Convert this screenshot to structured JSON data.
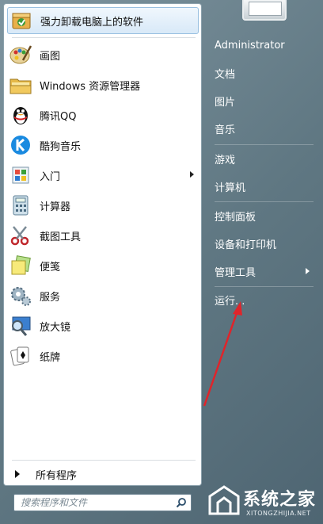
{
  "left_pane": {
    "pinned": {
      "label": "强力卸载电脑上的软件",
      "icon": "uninstall-box-icon"
    },
    "programs": [
      {
        "label": "画图",
        "icon": "paint-palette-icon",
        "submenu": false
      },
      {
        "label": "Windows 资源管理器",
        "icon": "folder-explorer-icon",
        "submenu": false
      },
      {
        "label": "腾讯QQ",
        "icon": "qq-penguin-icon",
        "submenu": false
      },
      {
        "label": "酷狗音乐",
        "icon": "kugou-k-icon",
        "submenu": false
      },
      {
        "label": "入门",
        "icon": "getting-started-icon",
        "submenu": true
      },
      {
        "label": "计算器",
        "icon": "calculator-icon",
        "submenu": false
      },
      {
        "label": "截图工具",
        "icon": "scissors-icon",
        "submenu": false
      },
      {
        "label": "便笺",
        "icon": "sticky-notes-icon",
        "submenu": false
      },
      {
        "label": "服务",
        "icon": "gears-icon",
        "submenu": false
      },
      {
        "label": "放大镜",
        "icon": "magnifier-icon",
        "submenu": false
      },
      {
        "label": "纸牌",
        "icon": "solitaire-cards-icon",
        "submenu": false
      }
    ],
    "all_programs_label": "所有程序",
    "search": {
      "placeholder": "搜索程序和文件",
      "value": ""
    }
  },
  "right_pane": {
    "links": [
      {
        "label": "Administrator",
        "submenu": false
      },
      {
        "label": "文档",
        "submenu": false
      },
      {
        "label": "图片",
        "submenu": false
      },
      {
        "label": "音乐",
        "submenu": false
      },
      {
        "label": "游戏",
        "submenu": false
      },
      {
        "label": "计算机",
        "submenu": false
      },
      {
        "label": "控制面板",
        "submenu": false
      },
      {
        "label": "设备和打印机",
        "submenu": false
      },
      {
        "label": "管理工具",
        "submenu": true
      },
      {
        "label": "运行...",
        "submenu": false
      }
    ]
  },
  "watermark": {
    "name": "系统之家",
    "url": "XITONGZHIJIA.NET"
  },
  "colors": {
    "annotation_arrow": "#e0242a",
    "highlight_border": "#98bfe0"
  }
}
